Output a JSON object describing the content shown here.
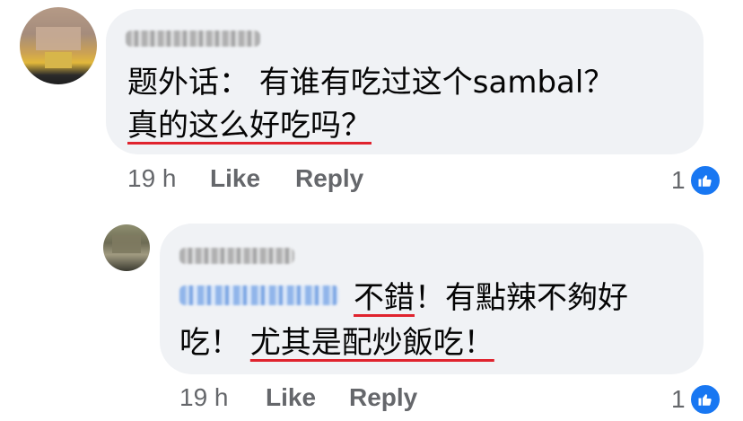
{
  "comments": [
    {
      "author_blurred": true,
      "lines": [
        "题外话： 有谁有吃过这个sambal？",
        "真的这么好吃吗？"
      ],
      "time": "19 h",
      "like_label": "Like",
      "reply_label": "Reply",
      "reaction_count": "1",
      "reaction_icon": "thumbs-up-icon"
    },
    {
      "author_blurred": true,
      "mention_blurred": true,
      "line1_underlined": "不錯",
      "line1_rest": "！有點辣不夠好",
      "line2_prefix": "吃！ ",
      "line2_underlined": "尤其是配炒飯吃！",
      "time": "19 h",
      "like_label": "Like",
      "reply_label": "Reply",
      "reaction_count": "1",
      "reaction_icon": "thumbs-up-icon"
    }
  ],
  "colors": {
    "bubble": "#f0f2f5",
    "underline": "#e0232e",
    "like_blue": "#1877f2",
    "meta_text": "#65676b"
  }
}
